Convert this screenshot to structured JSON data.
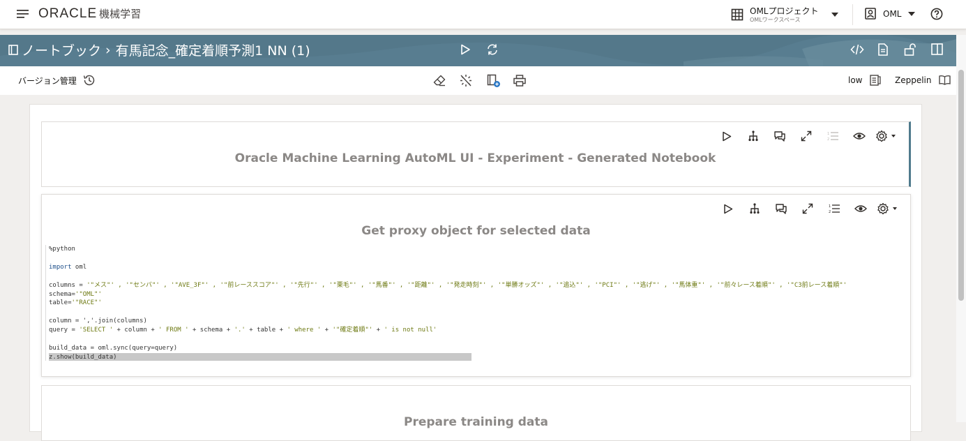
{
  "header": {
    "brand_logo": "ORACLE",
    "brand_product": "機械学習",
    "project_name": "OMLプロジェクト",
    "workspace_name": "OMLワークスペース",
    "user_name": "OML"
  },
  "banner": {
    "breadcrumb_root": "ノートブック",
    "breadcrumb_separator": "›",
    "notebook_name": "有馬記念_確定着順予測1 NN (1)"
  },
  "toolbar": {
    "version_label": "バージョン管理",
    "service_level": "low",
    "interpreter": "Zeppelin"
  },
  "paragraphs": [
    {
      "title": "Oracle Machine Learning AutoML UI - Experiment - Generated Notebook"
    },
    {
      "title": "Get proxy object for selected data",
      "code": {
        "line1": "%python",
        "line2_kw": "import",
        "line2_rest": " oml",
        "line3_pre": "columns = ",
        "line3_str": "'\"メス\"' , '\"センバ\"' , '\"AVE_3F\"' , '\"前レーススコア\"' , '\"先行\"' , '\"栗毛\"' , '\"馬番\"' , '\"距離\"' , '\"発走時刻\"' , '\"単勝オッズ\"' , '\"追込\"' , '\"PCI\"' , '\"逃げ\"' , '\"馬体重\"' , '\"前々レース着順\"' , '\"C3前レース着順\"'",
        "line4_pre": "schema=",
        "line4_str": "'\"OML\"'",
        "line5_pre": "table=",
        "line5_str": "'\"RACE\"'",
        "line6": "column = ','.join(columns)",
        "line7_pre": "query = ",
        "line7_s1": "'SELECT '",
        "line7_m1": " + column + ",
        "line7_s2": "' FROM '",
        "line7_m2": " + schema + ",
        "line7_s3": "'.'",
        "line7_m3": " + table + ",
        "line7_s4": "' where '",
        "line7_m4": " + ",
        "line7_s5": "'\"確定着順\"'",
        "line7_m5": " + ",
        "line7_s6": "' is not null'",
        "line8": "build_data = oml.sync(query=query)",
        "line9": "z.show(build_data)"
      }
    },
    {
      "title": "Prepare training data"
    }
  ]
}
